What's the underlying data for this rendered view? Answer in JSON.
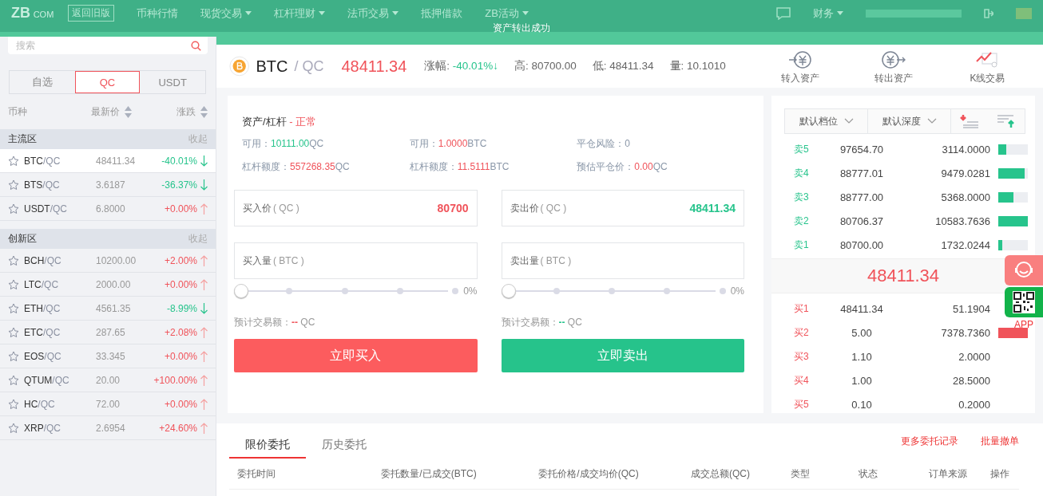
{
  "nav": {
    "logo_main": "ZB",
    "logo_sub": "COM",
    "old_version": "返回旧版",
    "items": [
      {
        "label": "币种行情",
        "dropdown": false
      },
      {
        "label": "现货交易",
        "dropdown": true
      },
      {
        "label": "杠杆理财",
        "dropdown": true
      },
      {
        "label": "法币交易",
        "dropdown": true
      },
      {
        "label": "抵押借款",
        "dropdown": false
      },
      {
        "label": "ZB活动",
        "dropdown": true
      }
    ],
    "finance": "财务"
  },
  "toast": {
    "message": "资产转出成功"
  },
  "sidebar": {
    "search": {
      "placeholder": "搜索"
    },
    "tabs": [
      {
        "label": "自选",
        "selected": false
      },
      {
        "label": "QC",
        "selected": true
      },
      {
        "label": "USDT",
        "selected": false
      }
    ],
    "columns": [
      {
        "label": "币种",
        "sortable": false
      },
      {
        "label": "最新价",
        "sortable": true
      },
      {
        "label": "涨跌",
        "sortable": true
      }
    ],
    "sections": [
      {
        "title": "主流区",
        "toggle": "收起",
        "rows": [
          {
            "base": "BTC",
            "quote": "/QC",
            "price": "48411.34",
            "change": "-40.01%",
            "falling": true,
            "selected": true
          },
          {
            "base": "BTS",
            "quote": "/QC",
            "price": "3.6187",
            "change": "-36.37%",
            "falling": true,
            "selected": false
          },
          {
            "base": "USDT",
            "quote": "/QC",
            "price": "6.8000",
            "change": "+0.00%",
            "falling": false,
            "selected": false
          }
        ]
      },
      {
        "title": "创新区",
        "toggle": "收起",
        "rows": [
          {
            "base": "BCH",
            "quote": "/QC",
            "price": "10200.00",
            "change": "+2.00%",
            "falling": false,
            "selected": false
          },
          {
            "base": "LTC",
            "quote": "/QC",
            "price": "2000.00",
            "change": "+0.00%",
            "falling": false,
            "selected": false
          },
          {
            "base": "ETH",
            "quote": "/QC",
            "price": "4561.35",
            "change": "-8.99%",
            "falling": true,
            "selected": false
          },
          {
            "base": "ETC",
            "quote": "/QC",
            "price": "287.65",
            "change": "+2.08%",
            "falling": false,
            "selected": false
          },
          {
            "base": "EOS",
            "quote": "/QC",
            "price": "33.345",
            "change": "+0.00%",
            "falling": false,
            "selected": false
          },
          {
            "base": "QTUM",
            "quote": "/QC",
            "price": "20.00",
            "change": "+100.00%",
            "falling": false,
            "selected": false
          },
          {
            "base": "HC",
            "quote": "/QC",
            "price": "72.00",
            "change": "+0.00%",
            "falling": false,
            "selected": false
          },
          {
            "base": "XRP",
            "quote": "/QC",
            "price": "2.6954",
            "change": "+24.60%",
            "falling": false,
            "selected": false
          }
        ]
      }
    ]
  },
  "ticker": {
    "coin": "BTC",
    "quote": "/ QC",
    "price": "48411.34",
    "stats": [
      {
        "label": "涨幅:",
        "value": "-40.01%↓",
        "color": "#27c48c"
      },
      {
        "label": "高:",
        "value": "80700.00"
      },
      {
        "label": "低:",
        "value": "48411.34"
      },
      {
        "label": "量:",
        "value": "10.1010"
      }
    ],
    "actions": [
      {
        "label": "转入资产",
        "kind": "transferin"
      },
      {
        "label": "转出资产",
        "kind": "transferout"
      },
      {
        "label": "K线交易",
        "kind": "kline"
      }
    ]
  },
  "account": {
    "title": "资产/杠杆",
    "status": "- 正常",
    "stats": [
      {
        "label": "可用：",
        "value": "10111.00",
        "unit": "QC",
        "color": "#27c48c"
      },
      {
        "label": "可用：",
        "value": "1.0000",
        "unit": "BTC",
        "color": "#f0535a"
      },
      {
        "label": "平仓风险：",
        "value": "0"
      },
      {
        "label": "杠杆额度：",
        "value": "557268.35",
        "unit": "QC",
        "color": "#f0535a"
      },
      {
        "label": "杠杆额度：",
        "value": "11.5111",
        "unit": "BTC",
        "color": "#f0535a"
      },
      {
        "label": "预估平仓价：",
        "value": "0.00",
        "unit": "QC",
        "color": "#f0535a"
      }
    ]
  },
  "forms": [
    {
      "kind": "buy",
      "price_label": "买入价",
      "price_unit": "( QC )",
      "price_value": "80700",
      "amount_label": "买入量",
      "amount_unit": "( BTC )",
      "level": 0,
      "percent": "0%",
      "estimate_label": "预计交易额：",
      "estimate_value": "--",
      "estimate_unit": "QC",
      "button": "立即买入"
    },
    {
      "kind": "sell",
      "price_label": "卖出价",
      "price_unit": "( QC )",
      "price_value": "48411.34",
      "amount_label": "卖出量",
      "amount_unit": "( BTC )",
      "level": 0,
      "percent": "0%",
      "estimate_label": "预计交易额：",
      "estimate_value": "--",
      "estimate_unit": "QC",
      "button": "立即卖出"
    }
  ],
  "orderbook": {
    "dropdowns": [
      "默认档位",
      "默认深度"
    ],
    "asks": [
      {
        "label": "卖5",
        "price": "97654.70",
        "amount": "3114.0000",
        "level": 0.27
      },
      {
        "label": "卖4",
        "price": "88777.01",
        "amount": "9479.0281",
        "level": 0.9
      },
      {
        "label": "卖3",
        "price": "88777.00",
        "amount": "5368.0000",
        "level": 0.51
      },
      {
        "label": "卖2",
        "price": "80706.37",
        "amount": "10583.7636",
        "level": 1
      },
      {
        "label": "卖1",
        "price": "80700.00",
        "amount": "1732.0244",
        "level": 0.14
      }
    ],
    "last_price": "48411.34",
    "bids": [
      {
        "label": "买1",
        "price": "48411.34",
        "amount": "51.1904"
      },
      {
        "label": "买2",
        "price": "5.00",
        "amount": "7378.7360",
        "level": 1
      },
      {
        "label": "买3",
        "price": "1.10",
        "amount": "2.0000"
      },
      {
        "label": "买4",
        "price": "1.00",
        "amount": "28.5000"
      },
      {
        "label": "买5",
        "price": "0.10",
        "amount": "0.2000"
      }
    ]
  },
  "float": {
    "app_label": "APP"
  },
  "orders": {
    "tabs": [
      {
        "label": "限价委托",
        "selected": true
      },
      {
        "label": "历史委托",
        "selected": false
      }
    ],
    "links": [
      "更多委托记录",
      "批量撤单"
    ],
    "columns": [
      "委托时间",
      "委托数量/已成交(BTC)",
      "委托价格/成交均价(QC)",
      "成交总额(QC)",
      "类型",
      "状态",
      "订单来源",
      "操作"
    ]
  }
}
